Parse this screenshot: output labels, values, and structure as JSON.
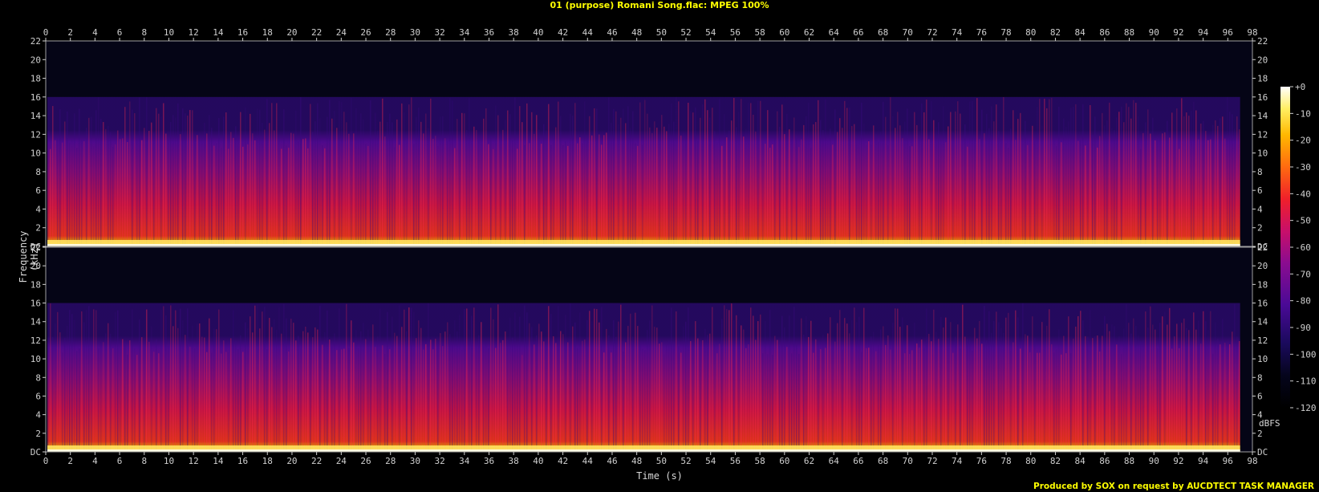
{
  "title": "01 (purpose) Romani Song.flac: MPEG 100%",
  "footer": "Produced by SOX on request by AUCDTECT TASK MANAGER",
  "colors": {
    "title": "#ffff00",
    "footer": "#ffff00",
    "background": "#000000",
    "axis": "#cfcfcf"
  },
  "chart_data": {
    "type": "heatmap",
    "xlabel": "Time (s)",
    "ylabel": "Frequency (kHz)",
    "colorbar_label": "dBFS",
    "x_range": [
      0,
      98
    ],
    "y_range": [
      0,
      22
    ],
    "x_ticks": [
      "0",
      "2",
      "4",
      "6",
      "8",
      "10",
      "12",
      "14",
      "16",
      "18",
      "20",
      "22",
      "24",
      "26",
      "28",
      "30",
      "32",
      "34",
      "36",
      "38",
      "40",
      "42",
      "44",
      "46",
      "48",
      "50",
      "52",
      "54",
      "56",
      "58",
      "60",
      "62",
      "64",
      "66",
      "68",
      "70",
      "72",
      "74",
      "76",
      "78",
      "80",
      "82",
      "84",
      "86",
      "88",
      "90",
      "92",
      "94",
      "96",
      "98"
    ],
    "y_ticks": [
      "DC",
      "2",
      "4",
      "6",
      "8",
      "10",
      "12",
      "14",
      "16",
      "18",
      "20",
      "22"
    ],
    "colorbar_ticks": [
      "+0",
      "-10",
      "-20",
      "-30",
      "-40",
      "-50",
      "-60",
      "-70",
      "-80",
      "-90",
      "-100",
      "-110",
      "-120"
    ],
    "colorbar_range_dbfs": [
      -120,
      0
    ],
    "channels": [
      {
        "name": "channel 1",
        "cutoff_khz": 16,
        "end_time_s": 97
      },
      {
        "name": "channel 2",
        "cutoff_khz": 16,
        "end_time_s": 97
      }
    ]
  }
}
